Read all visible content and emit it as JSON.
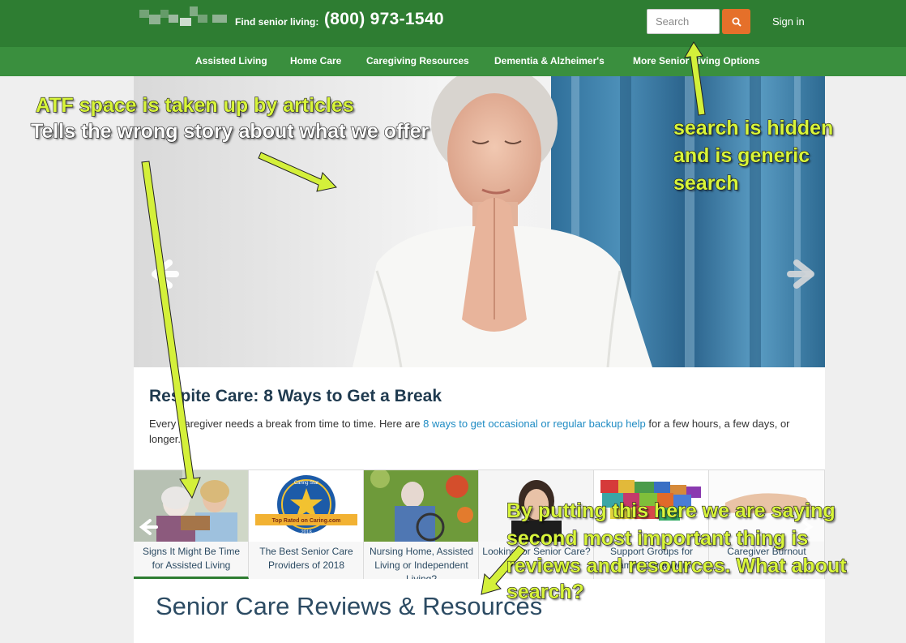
{
  "header": {
    "find_label": "Find senior living:",
    "phone": "(800) 973-1540",
    "search_placeholder": "Search",
    "signin": "Sign in"
  },
  "nav": {
    "items": [
      {
        "label": "Assisted Living"
      },
      {
        "label": "Home Care"
      },
      {
        "label": "Caregiving Resources"
      },
      {
        "label": "Dementia & Alzheimer's"
      },
      {
        "label": "More Senior Living Options"
      }
    ]
  },
  "featured": {
    "title": "Respite Care: 8 Ways to Get a Break",
    "body_before": "Every caregiver needs a break from time to time. Here are ",
    "body_link": "8 ways to get occasional or regular backup help",
    "body_after": " for a few hours, a few days, or longer."
  },
  "thumbnails": [
    {
      "caption": "Signs It Might Be Time for Assisted Living"
    },
    {
      "caption": "The Best Senior Care Providers of 2018",
      "badge_top": "Caring Star",
      "badge_ribbon": "Top Rated on Caring.com",
      "badge_year": "2018"
    },
    {
      "caption": "Nursing Home, Assisted Living or Independent Living?"
    },
    {
      "caption": "Looking for Senior Care?"
    },
    {
      "caption": "Support Groups for Family Caregivers"
    },
    {
      "caption": "Caregiver Burnout"
    }
  ],
  "section_title": "Senior Care Reviews & Resources",
  "annotations": {
    "atf_line1": "ATF space is taken up by articles",
    "atf_line2": "Tells the wrong story about what we offer",
    "search_line1": "search is hidden",
    "search_line2": "and is generic",
    "search_line3": "search",
    "bottom_line1": "By putting this here we are saying",
    "bottom_line2": "second most important thing is",
    "bottom_line3": "reviews and resources. What about",
    "bottom_line4": "search?"
  },
  "colors": {
    "header_green": "#2e7d32",
    "nav_green": "#3a8f3e",
    "search_orange": "#e5702a",
    "link_blue": "#1e8bc3",
    "annotation_yellow": "#d8f53a"
  }
}
